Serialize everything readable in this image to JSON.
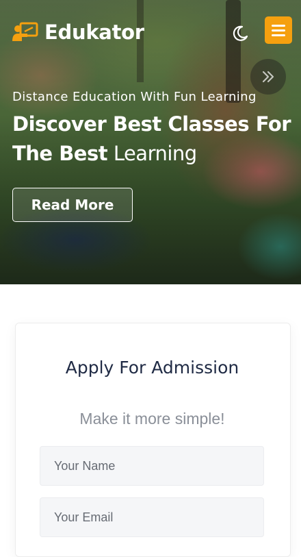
{
  "header": {
    "brand": "Edukator",
    "theme_toggle_icon": "moon-icon",
    "menu_icon": "hamburger-menu-icon",
    "accent_color": "#f5a00f"
  },
  "hero": {
    "subtitle": "Distance Education With Fun Learning",
    "title_bold": "Discover Best Classes For The Best",
    "title_light": "Learning",
    "button_label": "Read More",
    "next_icon": "double-chevron-right-icon"
  },
  "admission": {
    "title": "Apply For Admission",
    "subtitle": "Make it more simple!",
    "name_placeholder": "Your Name",
    "email_placeholder": "Your Email"
  }
}
